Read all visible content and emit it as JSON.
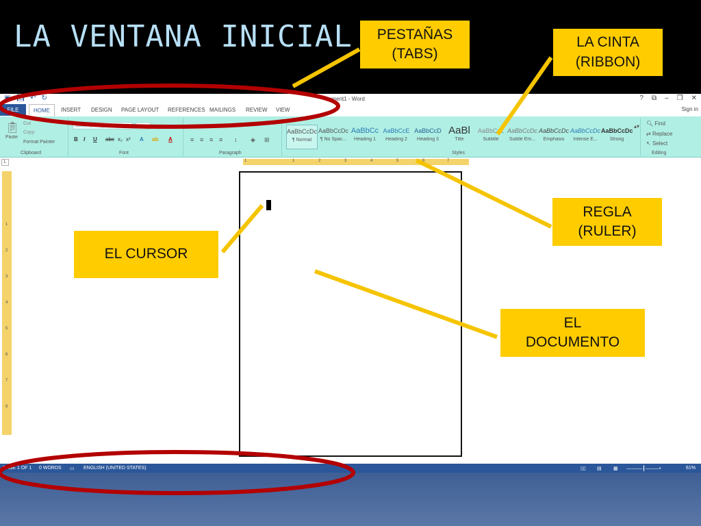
{
  "slide": {
    "title": "LA VENTANA INICIAL"
  },
  "callouts": {
    "tabs": {
      "line1": "PESTAÑAS",
      "line2": "(TABS)"
    },
    "ribbon": {
      "line1": "LA CINTA",
      "line2": "(RIBBON)"
    },
    "ruler": {
      "line1": "REGLA",
      "line2": "(RULER)"
    },
    "cursor": {
      "line1": "EL CURSOR"
    },
    "document": {
      "line1": "EL",
      "line2": "DOCUMENTO"
    }
  },
  "word": {
    "title": "ument1 - Word",
    "signin": "Sign in",
    "window_controls": [
      "?",
      "⧉",
      "–",
      "❐",
      "✕"
    ],
    "tabs": [
      "FILE",
      "HOME",
      "INSERT",
      "DESIGN",
      "PAGE LAYOUT",
      "REFERENCES",
      "MAILINGS",
      "REVIEW",
      "VIEW"
    ],
    "ribbon": {
      "clipboard": {
        "paste": "Paste",
        "cut": "Cut",
        "copy": "Copy",
        "format_painter": "Format Painter",
        "label": "Clipboard"
      },
      "font": {
        "name": "Calibri (Body)",
        "label": "Font",
        "buttons": [
          "B",
          "I",
          "U",
          "abc",
          "x₂",
          "x²"
        ]
      },
      "paragraph": {
        "label": "Paragraph"
      },
      "styles": {
        "label": "Styles",
        "items": [
          {
            "sample": "AaBbCcDc",
            "name": "¶ Normal"
          },
          {
            "sample": "AaBbCcDc",
            "name": "¶ No Spac..."
          },
          {
            "sample": "AaBbCc",
            "name": "Heading 1"
          },
          {
            "sample": "AaBbCcE",
            "name": "Heading 2"
          },
          {
            "sample": "AaBbCcD",
            "name": "Heading 3"
          },
          {
            "sample": "AaBl",
            "name": "Title"
          },
          {
            "sample": "AaBbCcL",
            "name": "Subtitle"
          },
          {
            "sample": "AaBbCcDc",
            "name": "Subtle Em..."
          },
          {
            "sample": "AaBbCcDc",
            "name": "Emphasis"
          },
          {
            "sample": "AaBbCcDc",
            "name": "Intense E..."
          },
          {
            "sample": "AaBbCcDc",
            "name": "Strong"
          }
        ]
      },
      "editing": {
        "find": "Find",
        "replace": "Replace",
        "select": "Select",
        "label": "Editing"
      }
    },
    "ruler_h": [
      "1",
      "1",
      "2",
      "3",
      "4",
      "5",
      "6",
      "7"
    ],
    "ruler_v": [
      "1",
      "2",
      "3",
      "4",
      "5",
      "6",
      "7",
      "8"
    ],
    "status": {
      "page": "PAGE 1 OF 1",
      "words": "0 WORDS",
      "language": "ENGLISH (UNITED STATES)",
      "zoom": "61%"
    }
  },
  "colors": {
    "callout": "#ffcc00",
    "connector": "#f5c400",
    "ellipse": "#b30000",
    "ribbon": "#b0efe4",
    "word_blue": "#2b579a",
    "title": "#b7dff5"
  }
}
